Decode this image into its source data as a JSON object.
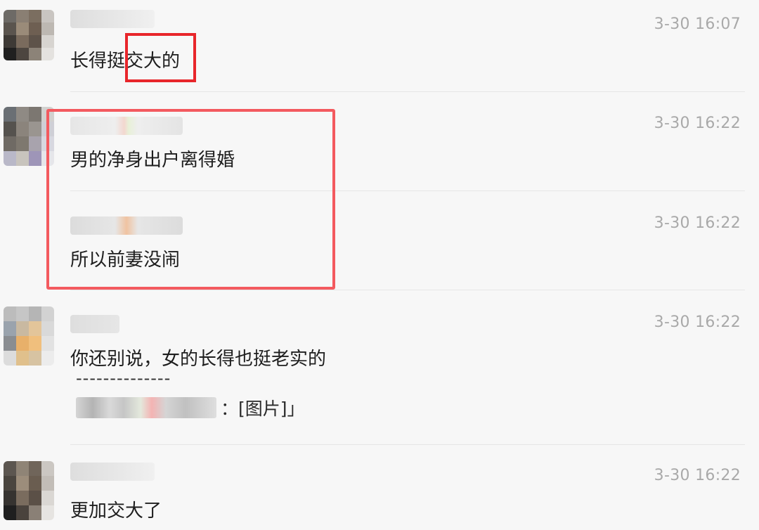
{
  "messages": [
    {
      "time": "3-30 16:07",
      "text": "长得挺交大的"
    },
    {
      "time": "3-30 16:22",
      "text": "男的净身出户离得婚"
    },
    {
      "time": "3-30 16:22",
      "text": "所以前妻没闹"
    },
    {
      "time": "3-30 16:22",
      "text": "你还别说，女的长得也挺老实的",
      "quote_divider": "--------------",
      "quote_suffix": "：[图片]」"
    },
    {
      "time": "3-30 16:22",
      "text": "更加交大了"
    }
  ]
}
